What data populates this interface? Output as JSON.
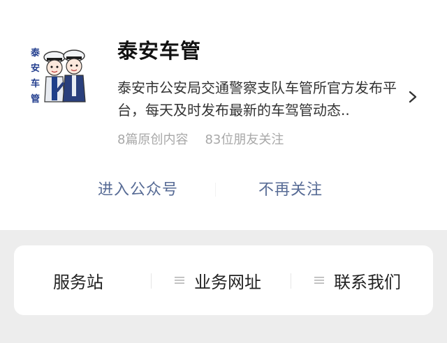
{
  "account": {
    "name": "泰安车管",
    "description": "泰安市公安局交通警察支队车管所官方发布平台，每天及时发布最新的车驾管动态..",
    "stats": {
      "articles": "8篇原创内容",
      "friends": "83位朋友关注"
    },
    "avatar_text": "泰安车管"
  },
  "actions": {
    "enter_label": "进入公众号",
    "unfollow_label": "不再关注"
  },
  "menu": {
    "items": [
      {
        "label": "服务站",
        "icon": "none"
      },
      {
        "label": "业务网址",
        "icon": "menu-lines-icon"
      },
      {
        "label": "联系我们",
        "icon": "menu-lines-icon"
      }
    ]
  },
  "colors": {
    "link": "#576b95",
    "background": "#ededed",
    "card": "#ffffff"
  }
}
